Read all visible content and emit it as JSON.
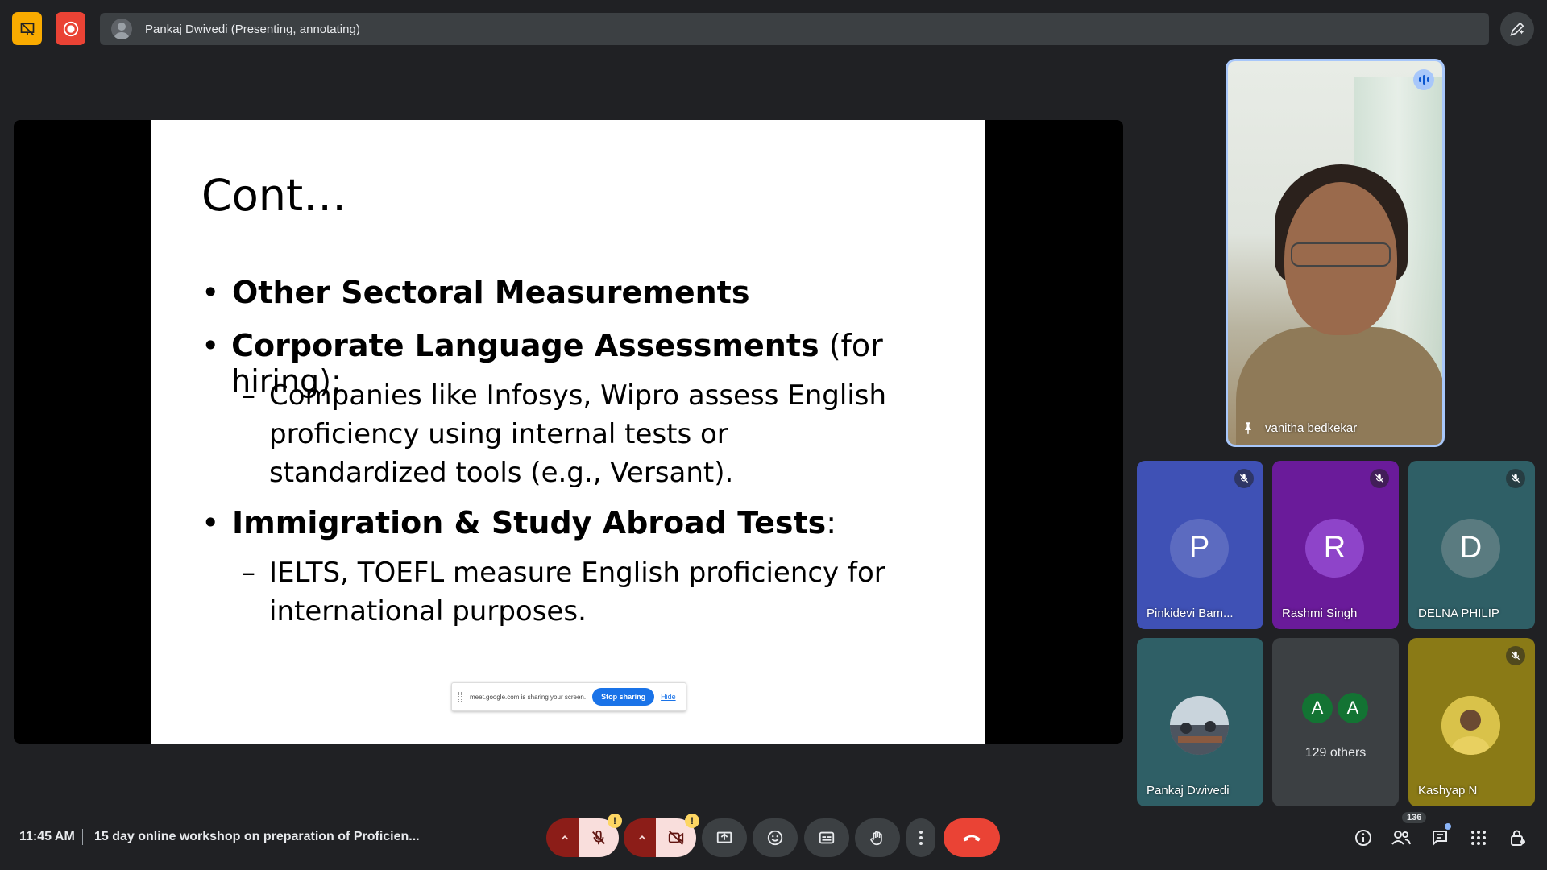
{
  "topbar": {
    "presenter_label": "Pankaj Dwivedi (Presenting, annotating)",
    "icons": [
      "presentation-off-icon",
      "record-icon",
      "annotate-pen-icon"
    ]
  },
  "slide": {
    "title": "Cont…",
    "bullets": [
      {
        "bold": "Other Sectoral Measurements",
        "rest": ""
      },
      {
        "bold": "Corporate Language Assessments",
        "rest": " (for hiring):"
      },
      {
        "bold": "Immigration & Study Abroad Tests",
        "rest": ":"
      }
    ],
    "subs": [
      "Companies like Infosys, Wipro assess English proficiency using internal tests or standardized tools (e.g., Versant).",
      "IELTS, TOEFL measure English proficiency for international purposes."
    ],
    "share_banner": {
      "text": "meet.google.com is sharing your screen.",
      "stop_label": "Stop sharing",
      "hide_label": "Hide"
    }
  },
  "speaker": {
    "name": "vanitha bedkekar"
  },
  "participants": [
    {
      "initial": "P",
      "name": "Pinkidevi Bam...",
      "bg": "#3f51b5",
      "avatar": "#5c6bc0",
      "muted": true
    },
    {
      "initial": "R",
      "name": "Rashmi Singh",
      "bg": "#6a1b9a",
      "avatar": "#8e44c9",
      "muted": true
    },
    {
      "initial": "D",
      "name": "DELNA PHILIP",
      "bg": "#2f5f66",
      "avatar": "#5a7b80",
      "muted": true
    },
    {
      "initial": "",
      "name": "Pankaj Dwivedi",
      "bg": "#2f5f66",
      "avatar": "#7d8a8f",
      "muted": false
    },
    {
      "initial": "",
      "name": "Kashyap N",
      "bg": "#8a7a16",
      "avatar": "#c8b040",
      "muted": true
    }
  ],
  "others": {
    "initials": [
      "A",
      "A"
    ],
    "label": "129 others"
  },
  "bottombar": {
    "time": "11:45 AM",
    "meeting_title": "15 day online workshop on preparation of Proficien...",
    "participant_count": "136",
    "warning_mark": "!"
  },
  "colors": {
    "background": "#202124",
    "end_call": "#ea4335",
    "active_border": "#a8c7fa",
    "mute_active": "#f9dedc"
  }
}
